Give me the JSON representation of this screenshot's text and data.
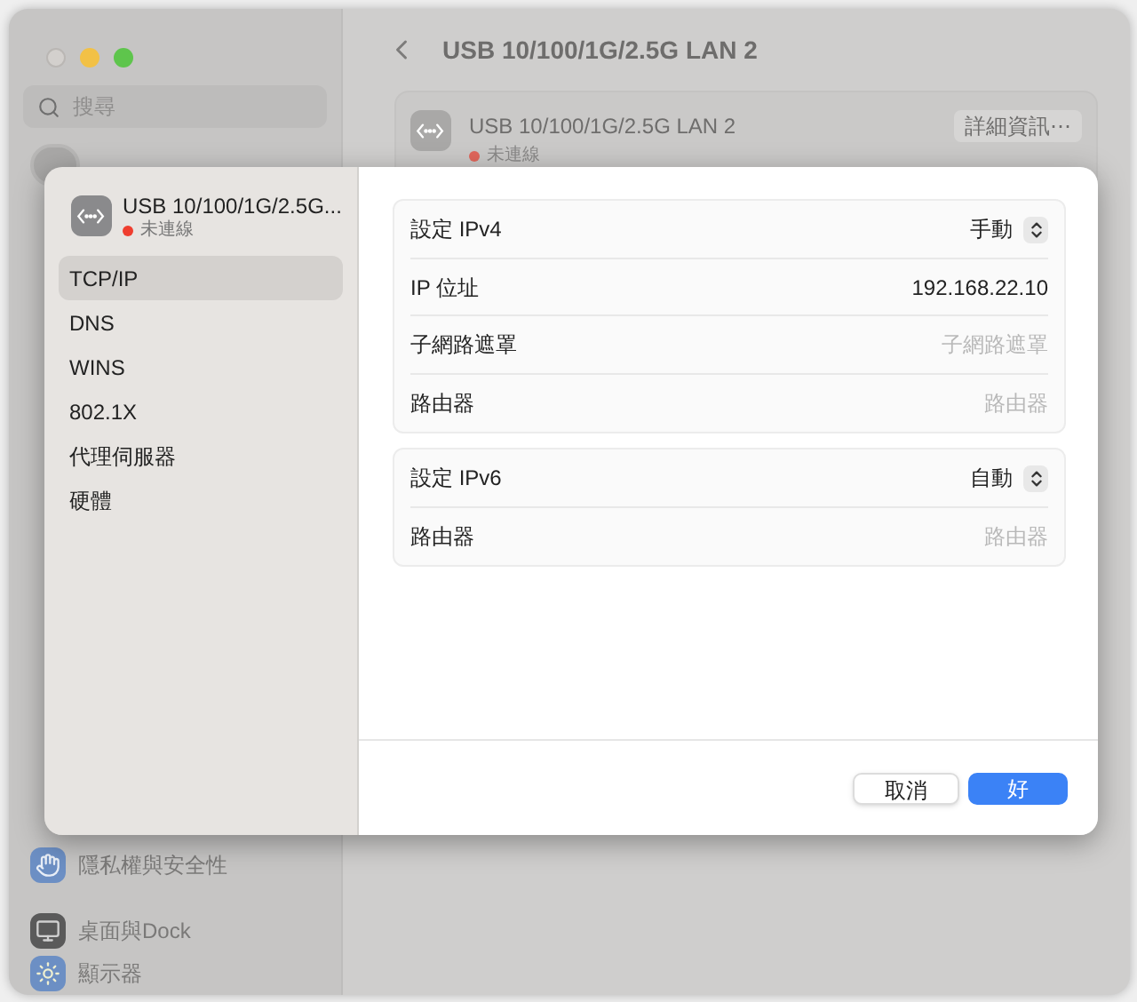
{
  "window": {
    "search_placeholder": "搜尋",
    "title": "USB 10/100/1G/2.5G LAN 2"
  },
  "sidebar": {
    "items": [
      {
        "label": "隱私權與安全性"
      },
      {
        "label": "桌面與Dock"
      },
      {
        "label": "顯示器"
      }
    ]
  },
  "device_card": {
    "name": "USB 10/100/1G/2.5G LAN 2",
    "status": "未連線",
    "details_button": "詳細資訊⋯"
  },
  "sheet": {
    "device": {
      "name": "USB 10/100/1G/2.5G...",
      "status": "未連線"
    },
    "nav": [
      {
        "label": "TCP/IP",
        "selected": true
      },
      {
        "label": "DNS",
        "selected": false
      },
      {
        "label": "WINS",
        "selected": false
      },
      {
        "label": "802.1X",
        "selected": false
      },
      {
        "label": "代理伺服器",
        "selected": false
      },
      {
        "label": "硬體",
        "selected": false
      }
    ],
    "groups": [
      {
        "rows": [
          {
            "kind": "popup",
            "label": "設定 IPv4",
            "value": "手動"
          },
          {
            "kind": "field",
            "label": "IP 位址",
            "value": "192.168.22.10"
          },
          {
            "kind": "field",
            "label": "子網路遮罩",
            "placeholder": "子網路遮罩"
          },
          {
            "kind": "field",
            "label": "路由器",
            "placeholder": "路由器"
          }
        ]
      },
      {
        "rows": [
          {
            "kind": "popup",
            "label": "設定 IPv6",
            "value": "自動"
          },
          {
            "kind": "field",
            "label": "路由器",
            "placeholder": "路由器"
          }
        ]
      }
    ],
    "buttons": [
      {
        "label": "取消",
        "kind": "normal"
      },
      {
        "label": "好",
        "kind": "default"
      }
    ]
  }
}
